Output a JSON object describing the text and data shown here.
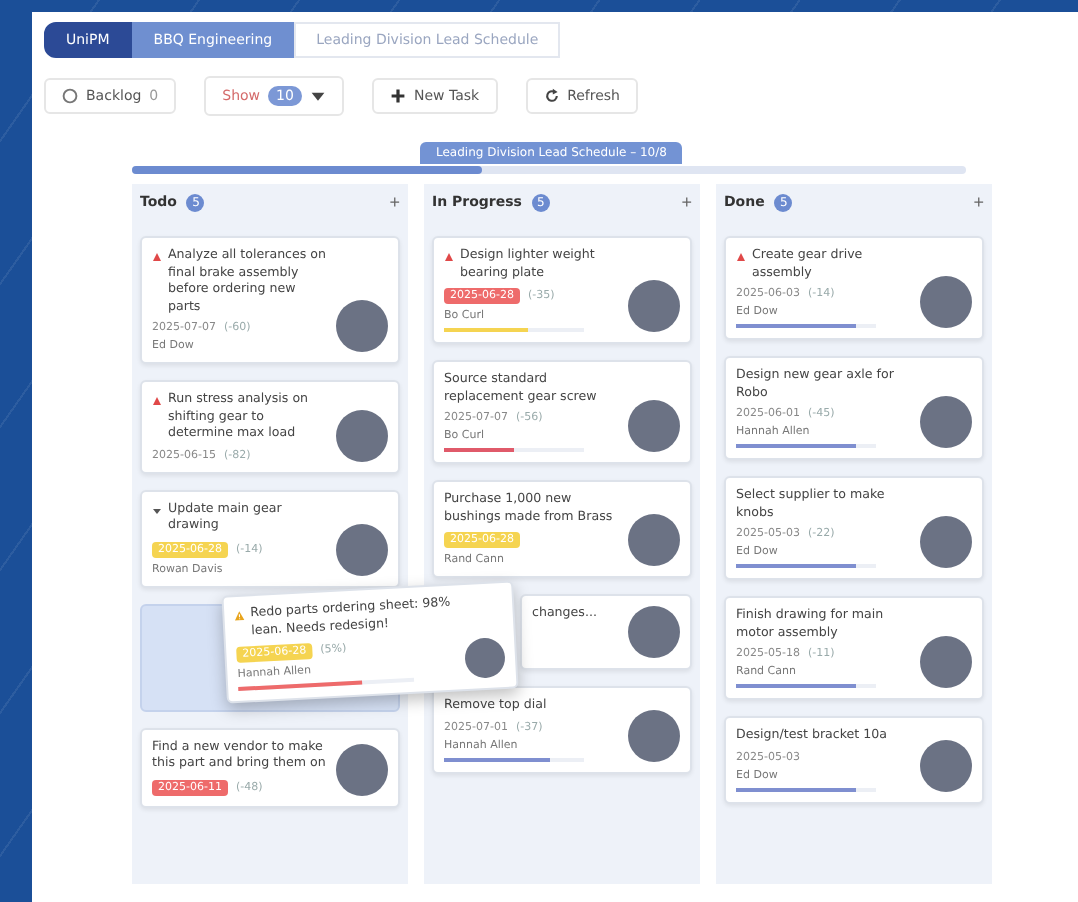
{
  "breadcrumb": [
    {
      "label": "UniPM",
      "selected": false
    },
    {
      "label": "BBQ Engineering",
      "selected": true
    },
    {
      "label": "Leading Division Lead Schedule",
      "selected": false
    }
  ],
  "toolbar": {
    "backlog": {
      "label": "Backlog",
      "count": "0"
    },
    "show": {
      "label": "Show",
      "count": "10"
    },
    "buttons": [
      "New Task",
      "Refresh"
    ]
  },
  "schedule": {
    "label": "Leading Division Lead Schedule – 10/8",
    "level": 0.42
  },
  "columns": [
    {
      "title": "Todo",
      "count": "5",
      "add": "+",
      "cards": [
        {
          "kind": "task",
          "title": "Analyze all tolerances on final brake assembly before ordering new parts",
          "flagged": true,
          "date": "2025-07-07",
          "offset": "(-60)",
          "owner": "Ed Dow"
        },
        {
          "kind": "task",
          "title": "Run stress analysis on shifting gear to determine max load",
          "flagged": true,
          "date": "2025-06-15",
          "offset": "(-82)"
        },
        {
          "kind": "collapsed",
          "title": "Update main gear drawing",
          "flagged": false,
          "due_tag": {
            "text": "2025-06-28",
            "color": "#f5d451"
          },
          "offset": "(-14)",
          "owner": "Rowan Davis"
        },
        {
          "kind": "placeholder"
        },
        {
          "kind": "task",
          "title": "Find a new vendor to make this part and bring them on",
          "flagged": false,
          "due_tag": {
            "text": "2025-06-11",
            "color": "#ee6b6b"
          },
          "offset": "(-48)"
        }
      ]
    },
    {
      "title": "In Progress",
      "count": "5",
      "add": "+",
      "cards": [
        {
          "kind": "task",
          "title": "Design lighter weight bearing plate",
          "flagged": true,
          "due_tag": {
            "text": "2025-06-28",
            "color": "#ee6b6b"
          },
          "offset": "(-35)",
          "owner": "Bo Curl",
          "progress": {
            "level": 0.6,
            "color": "#f5d451"
          }
        },
        {
          "kind": "task",
          "title": "Source standard replacement gear screw",
          "flagged": false,
          "date": "2025-07-07",
          "offset": "(-56)",
          "owner": "Bo Curl",
          "progress": {
            "level": 0.5,
            "color": "#e05a6a"
          }
        },
        {
          "kind": "task",
          "title": "Purchase 1,000 new bushings made from Brass",
          "flagged": false,
          "due_tag": {
            "text": "2025-06-28",
            "color": "#f5d451"
          },
          "owner": "Rand Cann"
        },
        {
          "kind": "covered",
          "title": "changes...",
          "flagged": false
        },
        {
          "kind": "task",
          "title": "Remove top dial",
          "flagged": false,
          "date": "2025-07-01",
          "offset": "(-37)",
          "owner": "Hannah Allen",
          "progress": {
            "level": 0.75,
            "color": "#7f8fd0"
          }
        }
      ]
    },
    {
      "title": "Done",
      "count": "5",
      "add": "+",
      "cards": [
        {
          "kind": "task",
          "title": "Create gear drive assembly",
          "flagged": true,
          "date": "2025-06-03",
          "offset": "(-14)",
          "owner": "Ed Dow",
          "progress": {
            "level": 0.85,
            "color": "#7f8fd0"
          }
        },
        {
          "kind": "task",
          "title": "Design new gear axle for Robo",
          "flagged": false,
          "date": "2025-06-01",
          "offset": "(-45)",
          "owner": "Hannah Allen",
          "progress": {
            "level": 0.85,
            "color": "#7f8fd0"
          }
        },
        {
          "kind": "task",
          "title": "Select supplier to make knobs",
          "flagged": false,
          "date": "2025-05-03",
          "offset": "(-22)",
          "owner": "Ed Dow",
          "progress": {
            "level": 0.85,
            "color": "#7f8fd0"
          }
        },
        {
          "kind": "task",
          "title": "Finish drawing for main motor assembly",
          "flagged": false,
          "date": "2025-05-18",
          "offset": "(-11)",
          "owner": "Rand Cann",
          "progress": {
            "level": 0.85,
            "color": "#7f8fd0"
          }
        },
        {
          "kind": "task",
          "title": "Design/test bracket 10a",
          "flagged": false,
          "date": "2025-05-03",
          "owner": "Ed Dow",
          "progress": {
            "level": 0.85,
            "color": "#7f8fd0"
          }
        }
      ]
    }
  ],
  "dragged_card": {
    "title": "Redo parts ordering sheet: 98% lean. Needs redesign!",
    "warning": true,
    "due_tag": {
      "text": "2025-06-28",
      "color": "#f5d451"
    },
    "offset": "(5%)",
    "owner": "Hannah Allen",
    "progress": {
      "level": 0.7,
      "color": "#ee6b6b"
    }
  }
}
